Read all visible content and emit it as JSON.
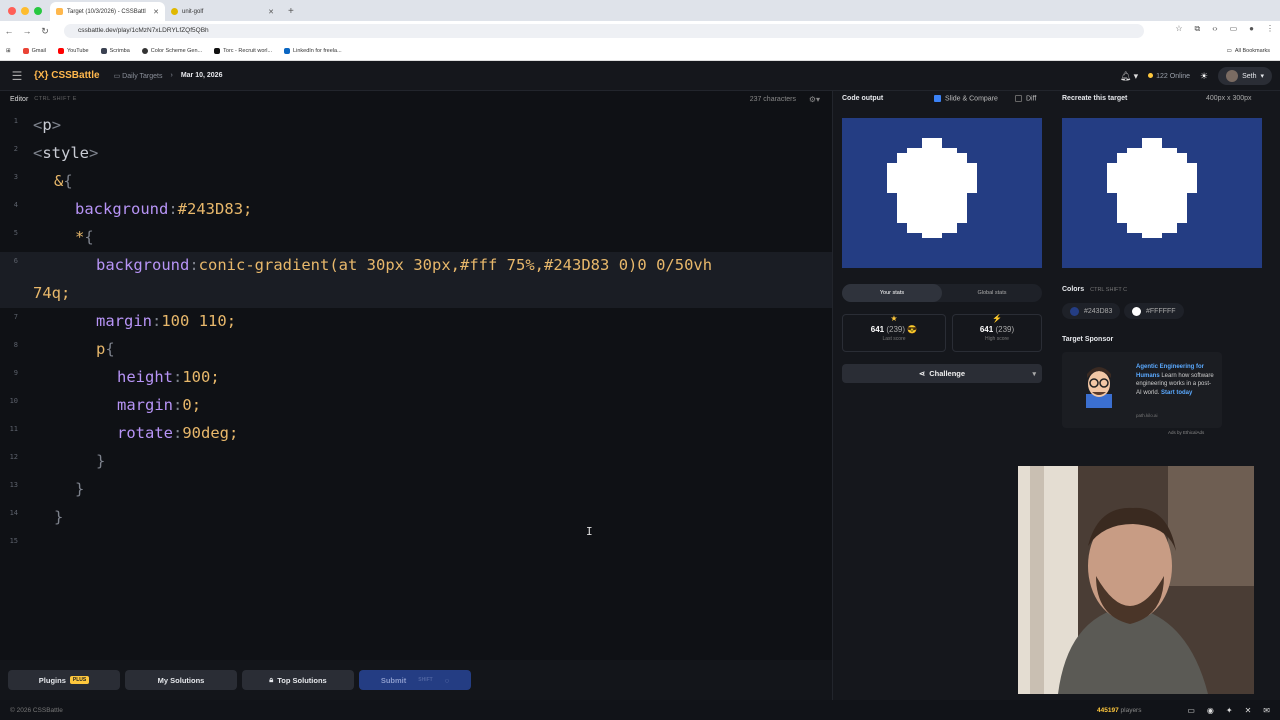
{
  "browser": {
    "tabs": [
      {
        "label": "Target (10/3/2026) - CSSBattl",
        "active": true
      },
      {
        "label": "unit-golf",
        "active": false
      }
    ],
    "url": "cssbattle.dev/play/1cMzN7xLDRYLfZQf5QBh",
    "bookmarks": [
      "Gmail",
      "YouTube",
      "Scrimba",
      "Color Scheme Gen...",
      "Torc - Recruit worl...",
      "LinkedIn for freela..."
    ],
    "all_bookmarks": "All Bookmarks"
  },
  "topbar": {
    "logo": "{X} CSSBattle",
    "breadcrumb_1": "Daily Targets",
    "breadcrumb_2": "Mar 10, 2026",
    "online": "122 Online",
    "user": "Seth"
  },
  "editor": {
    "title": "Editor",
    "shortcut": "CTRL SHIFT E",
    "chars": "237 characters",
    "lines": [
      "<p>",
      "<style>",
      "  &{",
      "    background:#243D83;",
      "    *{",
      "      background:conic-gradient(at 30px 30px,#fff 75%,#243D83 0)0 0/50vh",
      "74q;",
      "      margin:100 110;",
      "      p{",
      "        height:100;",
      "        margin:0;",
      "        rotate:90deg;",
      "      }",
      "    }",
      "  }",
      ""
    ],
    "line_numbers": [
      "1",
      "2",
      "3",
      "4",
      "5",
      "6",
      "7",
      "8",
      "9",
      "10",
      "11",
      "12",
      "13",
      "14",
      "15"
    ]
  },
  "bottom_buttons": {
    "plugins": "Plugins",
    "plus": "PLUS",
    "my_solutions": "My Solutions",
    "top_solutions": "Top Solutions",
    "submit": "Submit",
    "submit_sub": "SHIFT"
  },
  "output": {
    "title": "Code output",
    "slide_compare": "Slide & Compare",
    "diff": "Diff",
    "target_title": "Recreate this target",
    "size": "400px x 300px"
  },
  "stats": {
    "tab_yours": "Your stats",
    "tab_global": "Global stats",
    "last_score": "641",
    "last_score_chars": "(239)",
    "last_label": "Last score",
    "high_score": "641",
    "high_score_chars": "(239)",
    "high_label": "High score",
    "challenge": "Challenge"
  },
  "colors": {
    "title": "Colors",
    "shortcut": "CTRL SHIFT C",
    "c1": "#243D83",
    "c2": "#FFFFFF"
  },
  "sponsor": {
    "title": "Target Sponsor",
    "headline": "Agentic Engineering for Humans",
    "body": "Learn how software engineering works in a post-AI world.",
    "cta": "Start today",
    "domain": "path.kilo.ai",
    "ads_by": "Ads by EthicalAds"
  },
  "footer": {
    "copyright": "© 2026 CSSBattle",
    "players": "445197",
    "players_label": "players"
  },
  "theme": {
    "bg": "#0f1115",
    "canvas": "#243D83",
    "accent": "#ffc83d"
  }
}
